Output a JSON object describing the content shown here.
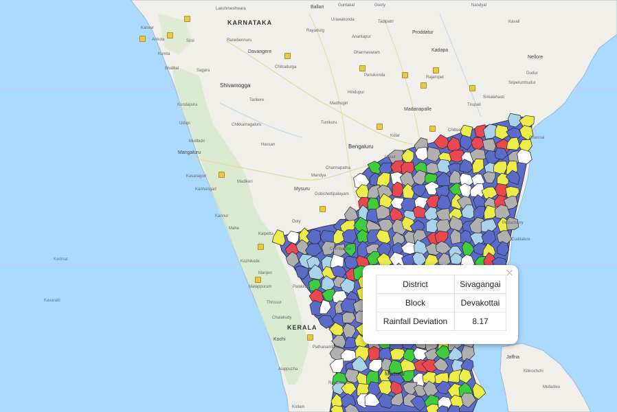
{
  "map": {
    "state_labels": [
      "KARNATAKA",
      "KERALA"
    ],
    "city_labels": [
      "Lakshmeshwara",
      "Ballari",
      "Guntakal",
      "Urawakonda",
      "Tadipatri",
      "Gooty",
      "Nandyal",
      "Karwar",
      "Sirsi",
      "Ranebennuru",
      "Rayadurg",
      "Anantapur",
      "Proddatur",
      "Kadapa",
      "Ankola",
      "Kumta",
      "Davangere",
      "Dharmavaram",
      "Chitradurga",
      "Kavali",
      "Penukonda",
      "Bhatkal",
      "Sagara",
      "Shivamogga",
      "Hindupur",
      "Rajampet",
      "Nellore",
      "Gudur",
      "Kundapura",
      "Tarikere",
      "Madhugiri",
      "Tirupati",
      "Sriperumbudur",
      "Srikalahasti",
      "Udupi",
      "Chikkamagaluru",
      "Tumkuru",
      "Madanapalle",
      "Chittoor",
      "Kolar",
      "Mangaluru",
      "Mudbidri",
      "Hassan",
      "Bengaluru",
      "Hosur",
      "Chennai",
      "Kasaragod",
      "Madikeri",
      "Channapatna",
      "Kanhangad",
      "Mandya",
      "Mysuru",
      "Kannur",
      "Mahe",
      "Kalpetta",
      "Gobichettipalayam",
      "Ooty",
      "Coimbatore",
      "Kozhikode",
      "Manjeri",
      "Palakkad",
      "Malappuram",
      "Thrissur",
      "Chalakudy",
      "Kochi",
      "Alappuzha",
      "Pathanamthitta",
      "Kollam",
      "Madurai",
      "Rajapalayam",
      "Jaffna",
      "Kilinochchi",
      "Mullaitivu",
      "Cuddalore",
      "Puducherry"
    ],
    "sea_labels": [
      "Kadmat",
      "Kavaratti"
    ],
    "road_shields": [
      "66",
      "75",
      "48",
      "44",
      "40",
      "42",
      "69",
      "716",
      "948",
      "544",
      "185",
      "766",
      "181",
      "85",
      "183",
      "32"
    ]
  },
  "popup": {
    "close_glyph": "×",
    "rows": [
      {
        "key": "District",
        "value": "Sivagangai"
      },
      {
        "key": "Block",
        "value": "Devakottai"
      },
      {
        "key": "Rainfall Deviation",
        "value": "8.17"
      }
    ]
  },
  "legend_colors": {
    "blue": "#5a6bc8",
    "green": "#3fcc3f",
    "yellow": "#ecec4a",
    "red": "#e8484f",
    "gray": "#b0b0b0",
    "white": "#ffffff",
    "lightblue": "#a9d3ea"
  }
}
